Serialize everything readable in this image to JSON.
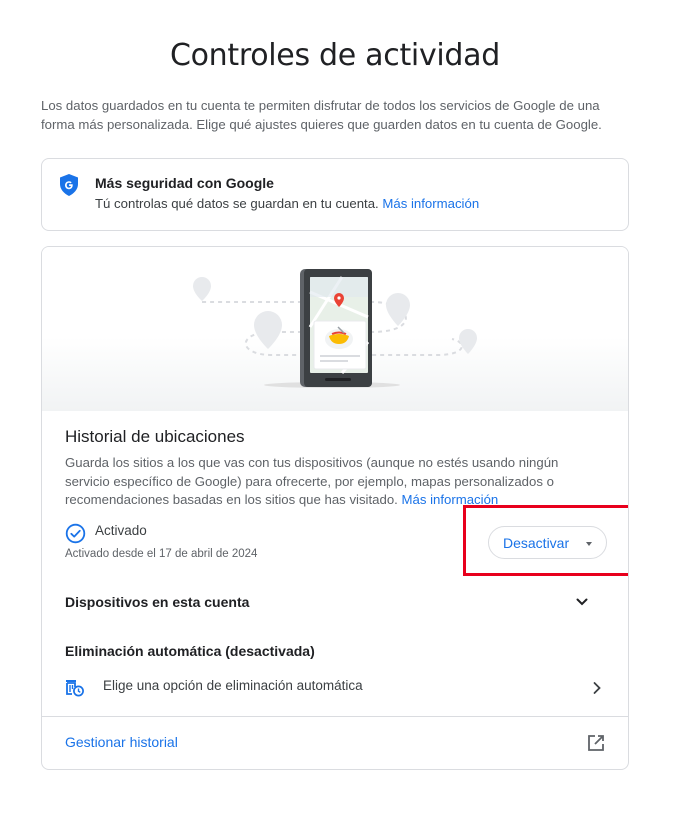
{
  "page": {
    "title": "Controles de actividad",
    "intro": "Los datos guardados en tu cuenta te permiten disfrutar de todos los servicios de Google de una forma más personalizada. Elige qué ajustes quieres que guarden datos en tu cuenta de Google."
  },
  "security_card": {
    "title": "Más seguridad con Google",
    "text": "Tú controlas qué datos se guardan en tu cuenta.",
    "link": "Más información",
    "icon": "google-shield-icon"
  },
  "location_history": {
    "title": "Historial de ubicaciones",
    "description": "Guarda los sitios a los que vas con tus dispositivos (aunque no estés usando ningún servicio específico de Google) para ofrecerte, por ejemplo, mapas personalizados o recomendaciones basadas en los sitios que has visitado.",
    "link": "Más información",
    "status": "Activado",
    "since": "Activado desde el 17 de abril de 2024",
    "button_label": "Desactivar",
    "devices_label": "Dispositivos en esta cuenta",
    "auto_delete_title": "Eliminación automática (desactivada)",
    "auto_delete_option": "Elige una opción de eliminación automática",
    "manage_label": "Gestionar historial"
  },
  "colors": {
    "link": "#1a73e8",
    "highlight": "#e8001c",
    "shield": "#1a73e8"
  }
}
